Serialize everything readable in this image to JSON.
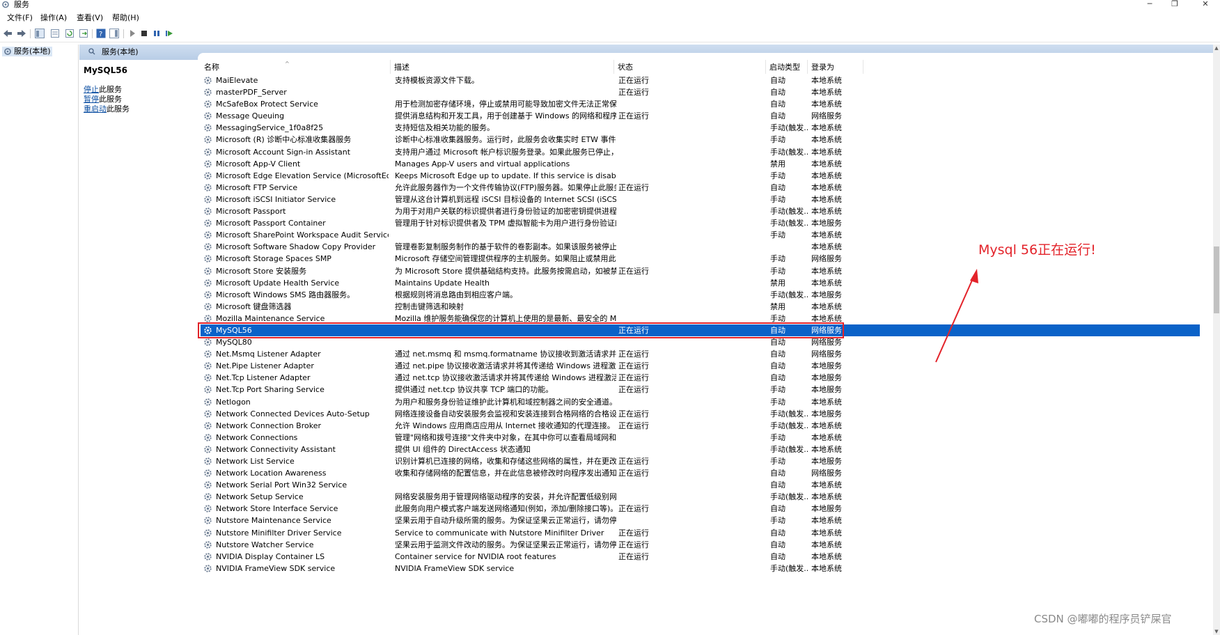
{
  "window": {
    "title": "服务",
    "min_glyph": "─",
    "max_glyph": "❐",
    "close_glyph": "✕"
  },
  "menu": [
    "文件(F)",
    "操作(A)",
    "查看(V)",
    "帮助(H)"
  ],
  "tree": {
    "root_label": "服务(本地)"
  },
  "pane": {
    "header_title": "服务(本地)"
  },
  "extended": {
    "service_name": "MySQL56",
    "stop_link": "停止",
    "stop_rest": "此服务",
    "pause_link": "暂停",
    "pause_rest": "此服务",
    "restart_link": "重启动",
    "restart_rest": "此服务"
  },
  "columns": {
    "name": "名称",
    "desc": "描述",
    "status": "状态",
    "startup": "启动类型",
    "logon": "登录为"
  },
  "services": [
    {
      "name": "MaiElevate",
      "desc": "支持模板资源文件下载。",
      "status": "正在运行",
      "startup": "自动",
      "logon": "本地系统"
    },
    {
      "name": "masterPDF_Server",
      "desc": "",
      "status": "正在运行",
      "startup": "自动",
      "logon": "本地系统"
    },
    {
      "name": "McSafeBox Protect Service",
      "desc": "用于检测加密存储环境，停止或禁用可能导致加密文件无法正常保存...",
      "status": "",
      "startup": "自动",
      "logon": "本地系统"
    },
    {
      "name": "Message Queuing",
      "desc": "提供消息结构和开发工具，用于创建基于 Windows 的网络和程序的...",
      "status": "正在运行",
      "startup": "自动",
      "logon": "网络服务"
    },
    {
      "name": "MessagingService_1f0a8f25",
      "desc": "支持短信及相关功能的服务。",
      "status": "",
      "startup": "手动(触发...",
      "logon": "本地系统"
    },
    {
      "name": "Microsoft (R) 诊断中心标准收集器服务",
      "desc": "诊断中心标准收集器服务。运行时，此服务会收集实时 ETW 事件，并...",
      "status": "",
      "startup": "手动",
      "logon": "本地系统"
    },
    {
      "name": "Microsoft Account Sign-in Assistant",
      "desc": "支持用户通过 Microsoft 帐户标识服务登录。如果此服务已停止，用...",
      "status": "",
      "startup": "手动(触发...",
      "logon": "本地系统"
    },
    {
      "name": "Microsoft App-V Client",
      "desc": "Manages App-V users and virtual applications",
      "status": "",
      "startup": "禁用",
      "logon": "本地系统"
    },
    {
      "name": "Microsoft Edge Elevation Service (MicrosoftEdgeEl...",
      "desc": "Keeps Microsoft Edge up to update. If this service is disabled, ...",
      "status": "",
      "startup": "手动",
      "logon": "本地系统"
    },
    {
      "name": "Microsoft FTP Service",
      "desc": "允许此服务器作为一个文件传输协议(FTP)服务器。如果停止此服务，...",
      "status": "正在运行",
      "startup": "自动",
      "logon": "本地系统"
    },
    {
      "name": "Microsoft iSCSI Initiator Service",
      "desc": "管理从这台计算机到远程 iSCSI 目标设备的 Internet SCSI (iSCSI)会...",
      "status": "",
      "startup": "手动",
      "logon": "本地系统"
    },
    {
      "name": "Microsoft Passport",
      "desc": "为用于对用户关联的标识提供者进行身份验证的加密密钥提供进程隔...",
      "status": "",
      "startup": "手动(触发...",
      "logon": "本地系统"
    },
    {
      "name": "Microsoft Passport Container",
      "desc": "管理用于针对标识提供者及 TPM 虚拟智能卡为用户进行身份验证的本...",
      "status": "",
      "startup": "手动(触发...",
      "logon": "本地服务"
    },
    {
      "name": "Microsoft SharePoint Workspace Audit Service",
      "desc": "",
      "status": "",
      "startup": "手动",
      "logon": "本地系统"
    },
    {
      "name": "Microsoft Software Shadow Copy Provider",
      "desc": "管理卷影复制服务制作的基于软件的卷影副本。如果该服务被停止，...",
      "status": "",
      "startup": "",
      "logon": "本地系统"
    },
    {
      "name": "Microsoft Storage Spaces SMP",
      "desc": "Microsoft 存储空间管理提供程序的主机服务。如果阻止或禁用此服务...",
      "status": "",
      "startup": "手动",
      "logon": "网络服务"
    },
    {
      "name": "Microsoft Store 安装服务",
      "desc": "为 Microsoft Store 提供基础结构支持。此服务按需启动，如被禁用...",
      "status": "正在运行",
      "startup": "手动",
      "logon": "本地系统"
    },
    {
      "name": "Microsoft Update Health Service",
      "desc": "Maintains Update Health",
      "status": "",
      "startup": "禁用",
      "logon": "本地系统"
    },
    {
      "name": "Microsoft Windows SMS 路由器服务。",
      "desc": "根据规则将消息路由到相应客户端。",
      "status": "",
      "startup": "手动(触发...",
      "logon": "本地服务"
    },
    {
      "name": "Microsoft 键盘筛选器",
      "desc": "控制击键筛选和映射",
      "status": "",
      "startup": "禁用",
      "logon": "本地系统"
    },
    {
      "name": "Mozilla Maintenance Service",
      "desc": "Mozilla 维护服务能确保您的计算机上使用的是最新、最安全的 Mozil...",
      "status": "",
      "startup": "手动",
      "logon": "本地系统"
    },
    {
      "name": "MySQL56",
      "desc": "",
      "status": "正在运行",
      "startup": "自动",
      "logon": "网络服务"
    },
    {
      "name": "MySQL80",
      "desc": "",
      "status": "",
      "startup": "自动",
      "logon": "网络服务"
    },
    {
      "name": "Net.Msmq Listener Adapter",
      "desc": "通过 net.msmq 和 msmq.formatname 协议接收到激活请求并将其...",
      "status": "正在运行",
      "startup": "自动",
      "logon": "网络服务"
    },
    {
      "name": "Net.Pipe Listener Adapter",
      "desc": "通过 net.pipe 协议接收激活请求并将其传递给 Windows 进程激活服...",
      "status": "正在运行",
      "startup": "自动",
      "logon": "本地服务"
    },
    {
      "name": "Net.Tcp Listener Adapter",
      "desc": "通过 net.tcp 协议接收激活请求并将其传递给 Windows 进程激活服...",
      "status": "正在运行",
      "startup": "自动",
      "logon": "本地服务"
    },
    {
      "name": "Net.Tcp Port Sharing Service",
      "desc": "提供通过 net.tcp 协议共享 TCP 端口的功能。",
      "status": "正在运行",
      "startup": "手动",
      "logon": "本地服务"
    },
    {
      "name": "Netlogon",
      "desc": "为用户和服务身份验证维护此计算机和域控制器之间的安全通道。如...",
      "status": "",
      "startup": "手动",
      "logon": "本地系统"
    },
    {
      "name": "Network Connected Devices Auto-Setup",
      "desc": "网络连接设备自动安装服务会监视和安装连接到合格网络的合格设备...",
      "status": "正在运行",
      "startup": "手动(触发...",
      "logon": "本地服务"
    },
    {
      "name": "Network Connection Broker",
      "desc": "允许 Windows 应用商店应用从 Internet 接收通知的代理连接。",
      "status": "正在运行",
      "startup": "手动(触发...",
      "logon": "本地系统"
    },
    {
      "name": "Network Connections",
      "desc": "管理\"网络和拨号连接\"文件夹中对象，在其中你可以查看局域网和远程...",
      "status": "",
      "startup": "手动",
      "logon": "本地系统"
    },
    {
      "name": "Network Connectivity Assistant",
      "desc": "提供 UI 组件的 DirectAccess 状态通知",
      "status": "",
      "startup": "手动(触发...",
      "logon": "本地系统"
    },
    {
      "name": "Network List Service",
      "desc": "识别计算机已连接的网络，收集和存储这些网络的属性，并在更改这...",
      "status": "正在运行",
      "startup": "手动",
      "logon": "本地服务"
    },
    {
      "name": "Network Location Awareness",
      "desc": "收集和存储网络的配置信息，并在此信息被修改时向程序发出通知。...",
      "status": "正在运行",
      "startup": "自动",
      "logon": "网络服务"
    },
    {
      "name": "Network Serial Port Win32 Service",
      "desc": "",
      "status": "",
      "startup": "自动",
      "logon": "本地系统"
    },
    {
      "name": "Network Setup Service",
      "desc": "网络安装服务用于管理网络驱动程序的安装，并允许配置低级别网络...",
      "status": "",
      "startup": "手动(触发...",
      "logon": "本地系统"
    },
    {
      "name": "Network Store Interface Service",
      "desc": "此服务向用户模式客户端发送网络通知(例如，添加/删除接口等)。停...",
      "status": "正在运行",
      "startup": "自动",
      "logon": "本地服务"
    },
    {
      "name": "Nutstore Maintenance Service",
      "desc": "坚果云用于自动升级所需的服务。为保证坚果云正常运行，请勿停止...",
      "status": "",
      "startup": "手动",
      "logon": "本地系统"
    },
    {
      "name": "Nutstore Minifilter Driver Service",
      "desc": "Service to communicate with Nutstore Minifilter Driver",
      "status": "正在运行",
      "startup": "自动",
      "logon": "本地系统"
    },
    {
      "name": "Nutstore Watcher Service",
      "desc": "坚果云用于监测文件改动的服务。为保证坚果云正常运行，请勿停止...",
      "status": "正在运行",
      "startup": "自动",
      "logon": "本地系统"
    },
    {
      "name": "NVIDIA Display Container LS",
      "desc": "Container service for NVIDIA root features",
      "status": "正在运行",
      "startup": "自动",
      "logon": "本地系统"
    },
    {
      "name": "NVIDIA FrameView SDK service",
      "desc": "NVIDIA FrameView SDK service",
      "status": "",
      "startup": "手动(触发...",
      "logon": "本地系统"
    }
  ],
  "selected_service": "MySQL56",
  "annotation": "Mysql 56正在运行!",
  "watermark": "CSDN @嘟嘟的程序员铲屎官",
  "colors": {
    "selection": "#0a62c8",
    "highlight_red": "#e3232a",
    "link": "#0b4ea2",
    "pane_header": "#c4d6ec"
  }
}
